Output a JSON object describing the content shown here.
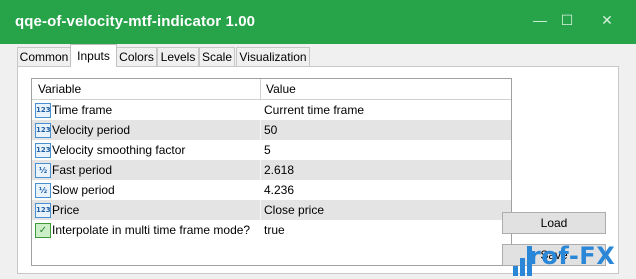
{
  "window": {
    "title": "qqe-of-velocity-mtf-indicator 1.00",
    "minimize_glyph": "—",
    "maximize_glyph": "☐",
    "close_glyph": "✕",
    "accent_color": "#27a34a"
  },
  "tabs": [
    {
      "label": "Common",
      "active": false
    },
    {
      "label": "Inputs",
      "active": true
    },
    {
      "label": "Colors",
      "active": false
    },
    {
      "label": "Levels",
      "active": false
    },
    {
      "label": "Scale",
      "active": false
    },
    {
      "label": "Visualization",
      "active": false
    }
  ],
  "grid": {
    "columns": {
      "variable": "Variable",
      "value": "Value"
    },
    "rows": [
      {
        "icon": "integer-type-icon",
        "glyph": "123",
        "variable": "Time frame",
        "value": "Current time frame"
      },
      {
        "icon": "integer-type-icon",
        "glyph": "123",
        "variable": "Velocity period",
        "value": "50"
      },
      {
        "icon": "integer-type-icon",
        "glyph": "123",
        "variable": "Velocity smoothing factor",
        "value": "5"
      },
      {
        "icon": "double-type-icon",
        "glyph": "½",
        "variable": "Fast period",
        "value": "2.618"
      },
      {
        "icon": "double-type-icon",
        "glyph": "½",
        "variable": "Slow period",
        "value": "4.236"
      },
      {
        "icon": "integer-type-icon",
        "glyph": "123",
        "variable": "Price",
        "value": "Close price"
      },
      {
        "icon": "boolean-type-icon",
        "glyph": "✓",
        "variable": "Interpolate in multi time frame mode?",
        "value": "true"
      }
    ]
  },
  "buttons": {
    "load": "Load",
    "save": "Save"
  },
  "watermark": {
    "text": "rof-FX",
    "icon": "bar-chart-logo-icon"
  }
}
